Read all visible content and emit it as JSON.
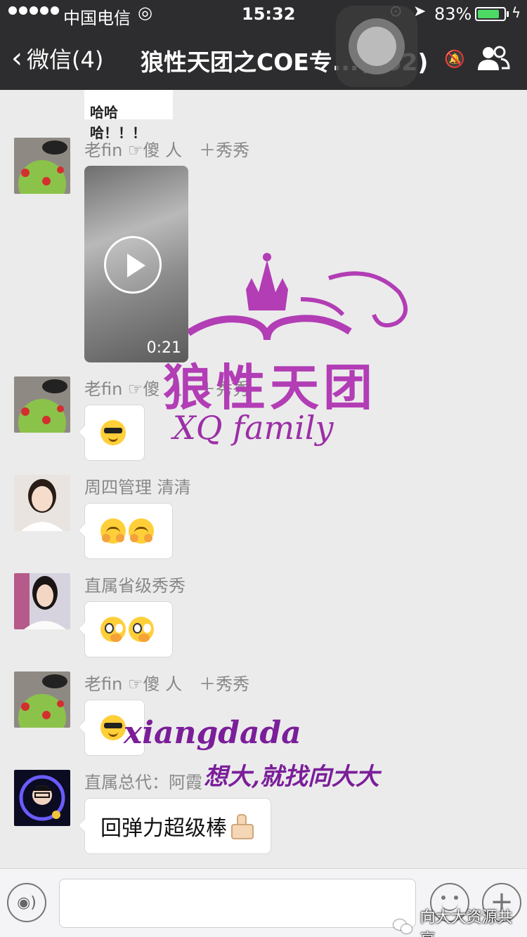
{
  "status_bar": {
    "carrier": "中国电信",
    "time": "15:32",
    "battery_percent": "83%",
    "battery_level": 0.83,
    "battery_color": "#4cd964",
    "icons": [
      "signal-dots-icon",
      "wifi-icon",
      "orientation-lock-icon",
      "location-arrow-icon",
      "battery-icon",
      "charging-bolt-icon"
    ]
  },
  "nav": {
    "back_label": "微信(4)",
    "title": "狼性天团之COE专...(252)",
    "icons": [
      "chevron-left-icon",
      "mute-bell-icon",
      "group-members-icon"
    ]
  },
  "partial_image_text": "哈哈哈！！！",
  "messages": [
    {
      "sender": "老fin ☞傻 人　＋秀秀",
      "type": "video",
      "duration": "0:21"
    },
    {
      "sender": "老fin ☞傻 人　＋秀秀",
      "type": "emoji",
      "emoji": [
        "cool-emoji-icon"
      ]
    },
    {
      "sender": "周四管理 清清",
      "type": "emoji",
      "emoji": [
        "hug-emoji-icon",
        "hug-emoji-icon"
      ]
    },
    {
      "sender": "直属省级秀秀",
      "type": "emoji",
      "emoji": [
        "thinking-emoji-icon",
        "thinking-emoji-icon"
      ]
    },
    {
      "sender": "老fin ☞傻 人　＋秀秀",
      "type": "emoji",
      "emoji": [
        "cool-emoji-icon"
      ]
    },
    {
      "sender": "直属总代：阿霞",
      "type": "text",
      "text": "回弹力超级棒",
      "emoji": [
        "thumbs-up-emoji-icon"
      ]
    }
  ],
  "watermark": {
    "name": "狼性天团",
    "family": "XQ family",
    "signature": "xiangdada",
    "slogan": "想大,就找向大大",
    "footer": "向大大资源共享",
    "color": "#a23bb8"
  },
  "input_bar": {
    "icons": [
      "voice-icon",
      "emoji-face-icon",
      "plus-icon"
    ]
  }
}
